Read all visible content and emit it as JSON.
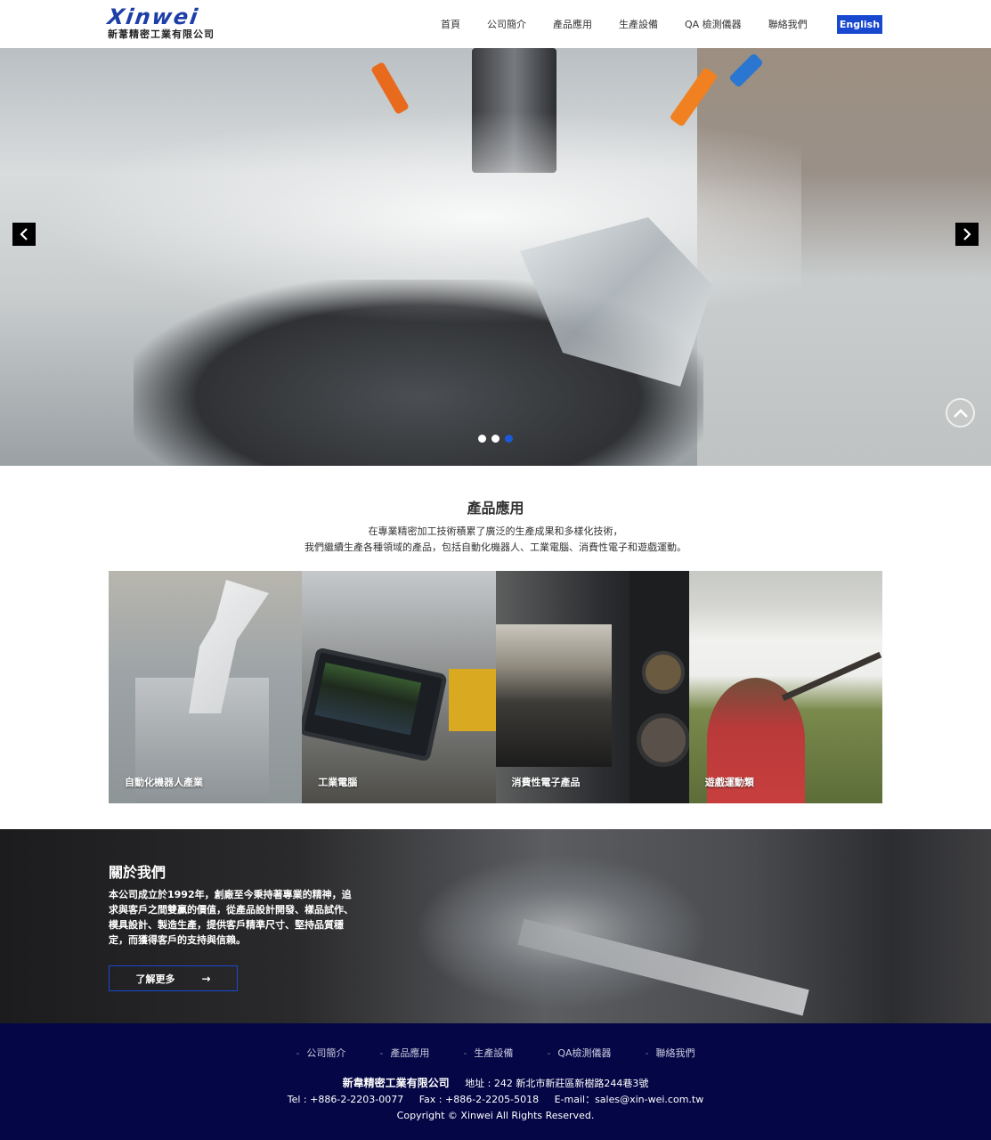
{
  "header": {
    "logo_mark": "Xinwei",
    "logo_sub": "新葦精密工業有限公司",
    "nav": [
      "首頁",
      "公司簡介",
      "產品應用",
      "生產設備",
      "QA 檢測儀器",
      "聯絡我們"
    ],
    "lang_button": "English"
  },
  "hero": {
    "prev_icon": "chevron-left-icon",
    "next_icon": "chevron-right-icon",
    "slide_count": 3,
    "active_slide": 3,
    "scroll_top_icon": "chevron-up-icon"
  },
  "products": {
    "title": "產品應用",
    "desc_line1": "在專業精密加工技術積累了廣泛的生產成果和多樣化技術，",
    "desc_line2": "我們繼續生產各種領域的產品，包括自動化機器人、工業電腦、消費性電子和遊戲運動。",
    "cards": [
      {
        "label": "自動化機器人產業"
      },
      {
        "label": "工業電腦"
      },
      {
        "label": "消費性電子產品"
      },
      {
        "label": "遊戲運動類"
      }
    ]
  },
  "about": {
    "title": "關於我們",
    "text": "本公司成立於1992年，創廠至今秉持著專業的精神，追求與客戶之間雙贏的價值，從產品設計開發、樣品試作、模具設計、製造生產，提供客戶精準尺寸、堅持品質穩定，而獲得客戶的支持與信賴。",
    "button_label": "了解更多",
    "button_arrow": "→"
  },
  "footer": {
    "links": [
      "公司簡介",
      "產品應用",
      "生產設備",
      "QA檢測儀器",
      "聯絡我們"
    ],
    "company": "新韋精密工業有限公司",
    "address": "地址 : 242 新北市新莊區新樹路244巷3號",
    "tel": "Tel : +886-2-2203-0077",
    "fax": "Fax : +886-2-2205-5018",
    "email": "E-mail：sales@xin-wei.com.tw",
    "copyright": "Copyright © Xinwei All Rights Reserved."
  },
  "colors": {
    "accent": "#1848d0",
    "footer_bg": "#040645",
    "active_dot": "#1a5ad8"
  }
}
